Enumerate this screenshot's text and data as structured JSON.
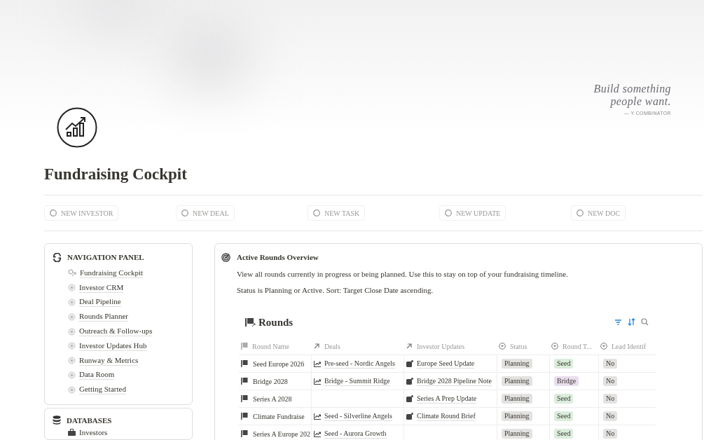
{
  "quote": {
    "text": "Build something people want.",
    "attribution": "— Y COMBINATOR"
  },
  "title": "Fundraising Cockpit",
  "quick_actions": [
    "NEW INVESTOR",
    "NEW DEAL",
    "NEW TASK",
    "NEW UPDATE",
    "NEW DOC"
  ],
  "navigation": {
    "title": "NAVIGATION PANEL",
    "items": [
      {
        "label": "Fundraising Cockpit",
        "kind": "arrow"
      },
      {
        "label": "Investor CRM",
        "kind": "dot"
      },
      {
        "label": "Deal Pipeline",
        "kind": "dot"
      },
      {
        "label": "Rounds Planner",
        "kind": "dot"
      },
      {
        "label": "Outreach & Follow-ups",
        "kind": "dot"
      },
      {
        "label": "Investor Updates Hub",
        "kind": "dot"
      },
      {
        "label": "Runway & Metrics",
        "kind": "dot"
      },
      {
        "label": "Data Room",
        "kind": "dot"
      },
      {
        "label": "Getting Started",
        "kind": "dot"
      }
    ]
  },
  "databases": {
    "title": "DATABASES",
    "items": [
      "Investors"
    ]
  },
  "overview": {
    "title": "Active Rounds Overview",
    "description": "View all rounds currently in progress or being planned. Use this to stay on top of your fundraising timeline.",
    "filter": "Status is Planning or Active. Sort: Target Close Date ascending."
  },
  "table": {
    "title": "Rounds",
    "columns": [
      {
        "label": "Round Name",
        "kind": "title"
      },
      {
        "label": "Deals",
        "kind": "relation"
      },
      {
        "label": "Investor Updates",
        "kind": "relation"
      },
      {
        "label": "Status",
        "kind": "select"
      },
      {
        "label": "Round T...",
        "kind": "select"
      },
      {
        "label": "Lead Identif",
        "kind": "select"
      }
    ],
    "rows": [
      {
        "round_name": "Seed Europe 2026",
        "deal": "Pre-seed - Nordic Angels",
        "investor_update": "Europe Seed Update",
        "status": "Planning",
        "round_type": {
          "label": "Seed",
          "color": "#dbeddb"
        },
        "lead_identified": "No"
      },
      {
        "round_name": "Bridge 2028",
        "deal": "Bridge - Summit Ridge",
        "investor_update": "Bridge 2028 Pipeline Note",
        "status": "Planning",
        "round_type": {
          "label": "Bridge",
          "color": "#e8deee"
        },
        "lead_identified": "No"
      },
      {
        "round_name": "Series A 2028",
        "investor_update": "Series A Prep Update",
        "status": "Planning",
        "round_type": {
          "label": "Seed",
          "color": "#dbeddb"
        },
        "lead_identified": "No"
      },
      {
        "round_name": "Climate Fundraise",
        "deal": "Seed - Silverline Angels",
        "investor_update": "Climate Round Brief",
        "status": "Planning",
        "round_type": {
          "label": "Seed",
          "color": "#dbeddb"
        },
        "lead_identified": "No"
      },
      {
        "round_name": "Series A Europe 202",
        "deal": "Seed - Aurora Growth",
        "status": "Planning",
        "round_type": {
          "label": "Seed",
          "color": "#dbeddb"
        },
        "lead_identified": "No"
      }
    ]
  }
}
